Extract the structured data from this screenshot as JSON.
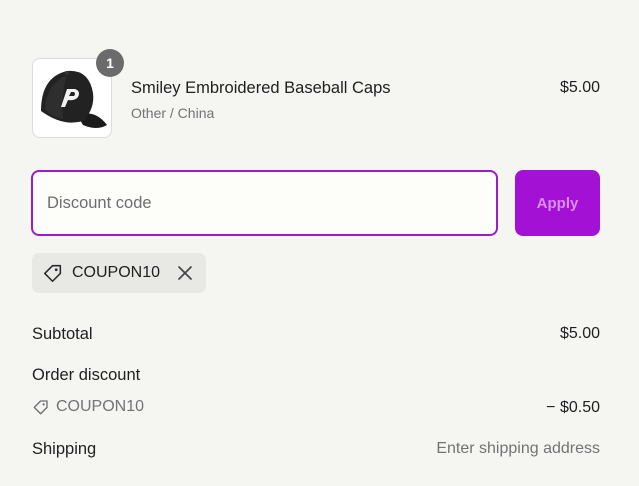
{
  "product": {
    "quantity": "1",
    "name": "Smiley Embroidered Baseball Caps",
    "variant": "Other / China",
    "price": "$5.00"
  },
  "discount": {
    "placeholder": "Discount code",
    "apply_label": "Apply"
  },
  "applied_coupon": {
    "code": "COUPON10",
    "icon": "tag-icon",
    "remove_icon": "close-icon"
  },
  "summary": {
    "subtotal_label": "Subtotal",
    "subtotal_value": "$5.00",
    "order_discount_label": "Order discount",
    "order_discount_code": "COUPON10",
    "order_discount_value": "− $0.50",
    "shipping_label": "Shipping",
    "shipping_value": "Enter shipping address"
  },
  "colors": {
    "accent": "#a311d4",
    "background": "#f5f5f2",
    "muted_text": "#737373"
  }
}
